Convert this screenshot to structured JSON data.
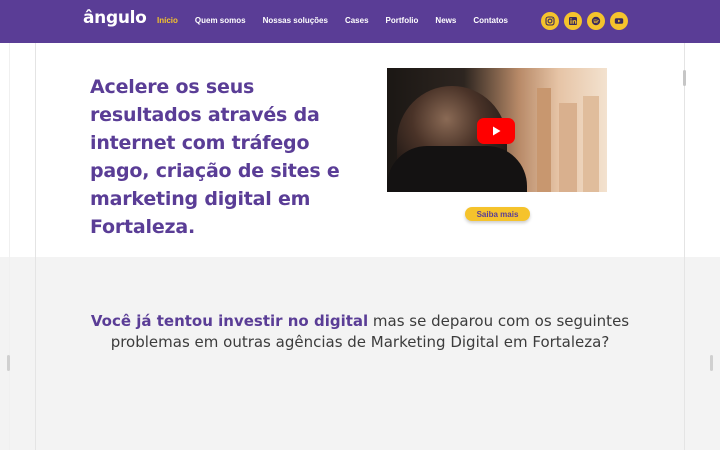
{
  "header": {
    "logo": "ângulo",
    "nav": [
      {
        "label": "Início",
        "active": true
      },
      {
        "label": "Quem somos",
        "active": false
      },
      {
        "label": "Nossas soluções",
        "active": false
      },
      {
        "label": "Cases",
        "active": false
      },
      {
        "label": "Portfolio",
        "active": false
      },
      {
        "label": "News",
        "active": false
      },
      {
        "label": "Contatos",
        "active": false
      }
    ],
    "socials": [
      "instagram-icon",
      "linkedin-icon",
      "spotify-icon",
      "youtube-icon"
    ]
  },
  "hero": {
    "headline": "Acelere os seus resultados através da internet com tráfego pago, criação de sites e marketing digital em Fortaleza.",
    "cta_label": "Saiba mais"
  },
  "problems": {
    "highlight": "Você já tentou investir no digital",
    "rest": " mas se deparou com os seguintes problemas em outras agências de Marketing Digital em Fortaleza?"
  },
  "colors": {
    "brand_purple": "#5a3d96",
    "accent_yellow": "#f5c32c",
    "section_gray": "#f3f3f3"
  }
}
